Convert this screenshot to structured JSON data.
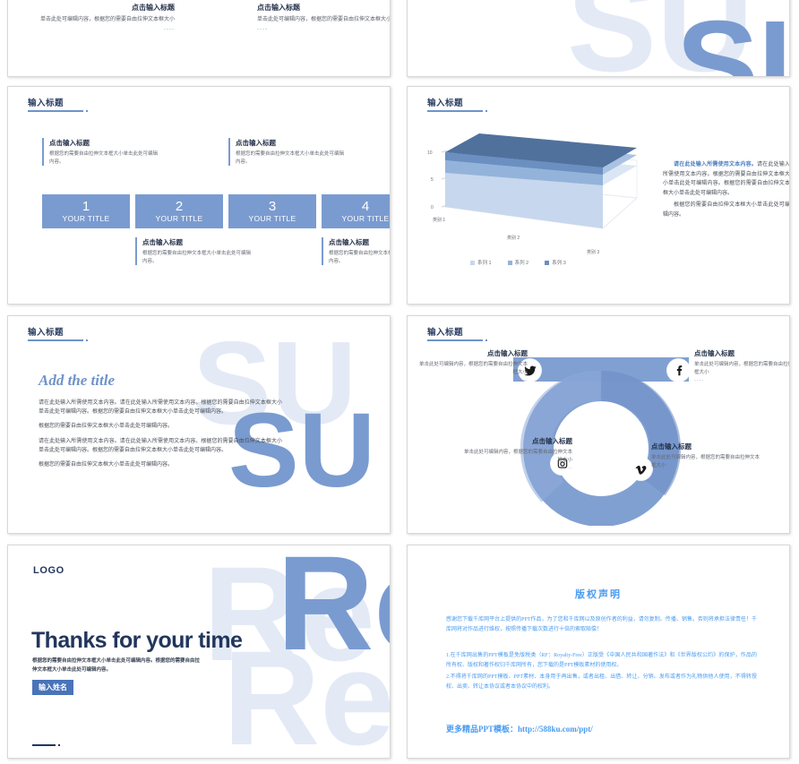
{
  "theme": {
    "accent": "#7a9bd0",
    "accent_dark": "#22365c",
    "pale": "#e3eaf6",
    "link_blue": "#4a9bf0",
    "button_blue": "#4a73b8"
  },
  "slides": {
    "s1": {
      "icons": [
        "phone-24h-icon",
        "pencil-icon",
        "refresh-arrows-icon"
      ],
      "left": {
        "title": "点击输入标题",
        "body": "单击此处可编辑内容，根据您的需要自由拉伸文本框大小",
        "dots": "----"
      },
      "right": {
        "title": "点击输入标题",
        "body": "单击此处可编辑内容，根据您的需要自由拉伸文本框大小",
        "dots": "----"
      }
    },
    "s2": {
      "bg_text_pale": "SU",
      "bg_text_mid": "SU"
    },
    "s3": {
      "section_title": "输入标题",
      "steps": [
        {
          "num": "1",
          "label": "YOUR TITLE"
        },
        {
          "num": "2",
          "label": "YOUR TITLE"
        },
        {
          "num": "3",
          "label": "YOUR TITLE"
        },
        {
          "num": "4",
          "label": "YOUR TITLE"
        }
      ],
      "captions": [
        {
          "title": "点击输入标题",
          "body": "根据您的需要自由拉伸文本框大小单击此处可编辑内容。"
        },
        {
          "title": "点击输入标题",
          "body": "根据您的需要自由拉伸文本框大小单击此处可编辑内容。"
        },
        {
          "title": "点击输入标题",
          "body": "根据您的需要自由拉伸文本框大小单击此处可编辑内容。"
        },
        {
          "title": "点击输入标题",
          "body": "根据您的需要自由拉伸文本框大小单击此处可编辑内容。"
        }
      ]
    },
    "s4": {
      "section_title": "输入标题",
      "text_lead_highlight": "请在此处输入所需使用文本内容。",
      "text_p1": "请在此处输入所需使用文本内容。根据您的需要自由拉伸文本框大小单击此处可编辑内容。根据您的需要自由拉伸文本框大小单击此处可编辑内容。",
      "text_p2": "根据您的需要自由拉伸文本框大小单击此处可编辑内容。"
    },
    "s5": {
      "section_title": "输入标题",
      "title": "Add the title",
      "p1": "请在此处输入所需使用文本内容。请在此处输入所需使用文本内容。根据您的需要自由拉伸文本框大小单击此处可编辑内容。根据您的需要自由拉伸文本框大小单击此处可编辑内容。",
      "p2": "根据您的需要自由拉伸文本框大小单击此处可编辑内容。",
      "p3": "请在此处输入所需使用文本内容。请在此处输入所需使用文本内容。根据您的需要自由拉伸文本框大小单击此处可编辑内容。根据您的需要自由拉伸文本框大小单击此处可编辑内容。",
      "p4": "根据您的需要自由拉伸文本框大小单击此处可编辑内容。",
      "bg_text_pale": "SU",
      "bg_text_mid": "SU"
    },
    "s6": {
      "section_title": "输入标题",
      "items": [
        {
          "icon": "twitter-icon",
          "title": "点击输入标题",
          "body": "单击此处可编辑内容，根据您的需要自由拉伸文本框大小",
          "dots": "----"
        },
        {
          "icon": "facebook-icon",
          "title": "点击输入标题",
          "body": "单击此处可编辑内容，根据您的需要自由拉伸文本框大小",
          "dots": "----"
        },
        {
          "icon": "instagram-icon",
          "title": "点击输入标题",
          "body": "单击此处可编辑内容，根据您的需要自由拉伸文本框大小",
          "dots": "----"
        },
        {
          "icon": "vimeo-icon",
          "title": "点击输入标题",
          "body": "单击此处可编辑内容，根据您的需要自由拉伸文本框大小",
          "dots": "----"
        }
      ]
    },
    "s7": {
      "logo": "LOGO",
      "headline": "Thanks for your time",
      "sub": "根据您的需要自由拉伸文本框大小单击此处可编辑内容。根据您的需要自由拉伸文本框大小单击此处可编辑内容。",
      "button": "输入姓名",
      "bg_text_mid": "Re",
      "bg_text_pale": "Re"
    },
    "s8": {
      "title": "版权声明",
      "para1": "感谢您下载千库网平台上提供的PPT作品，为了您和千库网以及原创作者的利益，请勿复制、传播、销售。否则将承担法律责任！千库网将对作品进行维权，按照传播下载次数进行十倍的索取赔偿！",
      "item1": "1.在千库网出售的PPT模板是免版税类（RF：Royalty-Free）正版受《中国人民共和国著作法》和《世界版权公约》的保护，作品的所有权、版权和著作权归千库网所有，您下载的是PPT模板素材的使用权。",
      "item2": "2.不得将千库网的PPT模板、PPT素材、本身用于再出售，或者出租、出借、转让、分销、发布或者作为礼物供他人使用，不得转授权、出卖、转让本协议或者本协议中的权利。",
      "more": "更多精品PPT模板：http://588ku.com/ppt/"
    }
  },
  "chart_data": {
    "type": "area",
    "title": "",
    "categories": [
      "类别 1",
      "类别 2",
      "类别 3"
    ],
    "series": [
      {
        "name": "系列 1",
        "values": [
          4.3,
          3.6,
          3.2
        ]
      },
      {
        "name": "系列 2",
        "values": [
          2.4,
          2.1,
          2.0
        ]
      },
      {
        "name": "系列 3",
        "values": [
          2.0,
          1.8,
          1.7
        ]
      }
    ],
    "ylabel": "",
    "xlabel": "",
    "ylim": [
      0,
      10
    ],
    "yticks": [
      "0",
      "5",
      "10"
    ],
    "grid": false,
    "legend_position": "bottom",
    "style": "3d-stacked-area"
  }
}
